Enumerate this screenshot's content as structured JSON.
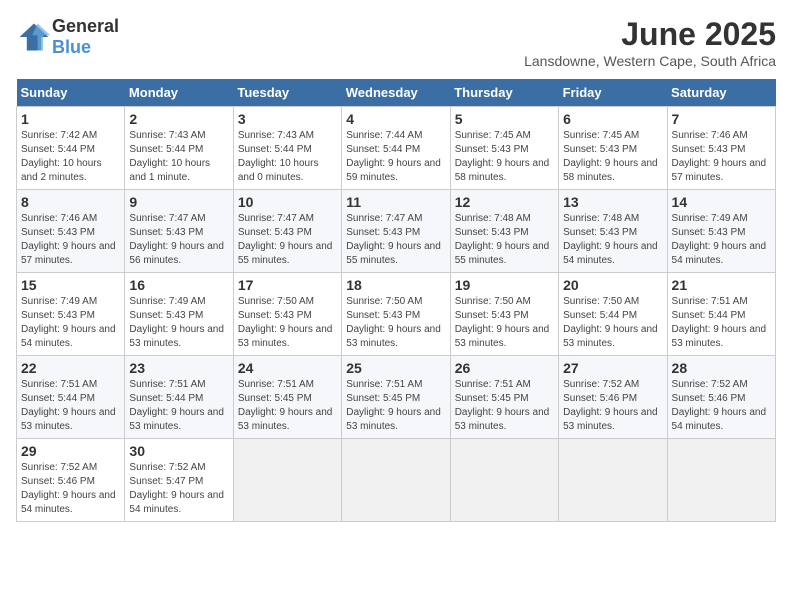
{
  "header": {
    "logo_general": "General",
    "logo_blue": "Blue",
    "title": "June 2025",
    "subtitle": "Lansdowne, Western Cape, South Africa"
  },
  "weekdays": [
    "Sunday",
    "Monday",
    "Tuesday",
    "Wednesday",
    "Thursday",
    "Friday",
    "Saturday"
  ],
  "weeks": [
    [
      {
        "day": "1",
        "sunrise": "Sunrise: 7:42 AM",
        "sunset": "Sunset: 5:44 PM",
        "daylight": "Daylight: 10 hours and 2 minutes."
      },
      {
        "day": "2",
        "sunrise": "Sunrise: 7:43 AM",
        "sunset": "Sunset: 5:44 PM",
        "daylight": "Daylight: 10 hours and 1 minute."
      },
      {
        "day": "3",
        "sunrise": "Sunrise: 7:43 AM",
        "sunset": "Sunset: 5:44 PM",
        "daylight": "Daylight: 10 hours and 0 minutes."
      },
      {
        "day": "4",
        "sunrise": "Sunrise: 7:44 AM",
        "sunset": "Sunset: 5:44 PM",
        "daylight": "Daylight: 9 hours and 59 minutes."
      },
      {
        "day": "5",
        "sunrise": "Sunrise: 7:45 AM",
        "sunset": "Sunset: 5:43 PM",
        "daylight": "Daylight: 9 hours and 58 minutes."
      },
      {
        "day": "6",
        "sunrise": "Sunrise: 7:45 AM",
        "sunset": "Sunset: 5:43 PM",
        "daylight": "Daylight: 9 hours and 58 minutes."
      },
      {
        "day": "7",
        "sunrise": "Sunrise: 7:46 AM",
        "sunset": "Sunset: 5:43 PM",
        "daylight": "Daylight: 9 hours and 57 minutes."
      }
    ],
    [
      {
        "day": "8",
        "sunrise": "Sunrise: 7:46 AM",
        "sunset": "Sunset: 5:43 PM",
        "daylight": "Daylight: 9 hours and 57 minutes."
      },
      {
        "day": "9",
        "sunrise": "Sunrise: 7:47 AM",
        "sunset": "Sunset: 5:43 PM",
        "daylight": "Daylight: 9 hours and 56 minutes."
      },
      {
        "day": "10",
        "sunrise": "Sunrise: 7:47 AM",
        "sunset": "Sunset: 5:43 PM",
        "daylight": "Daylight: 9 hours and 55 minutes."
      },
      {
        "day": "11",
        "sunrise": "Sunrise: 7:47 AM",
        "sunset": "Sunset: 5:43 PM",
        "daylight": "Daylight: 9 hours and 55 minutes."
      },
      {
        "day": "12",
        "sunrise": "Sunrise: 7:48 AM",
        "sunset": "Sunset: 5:43 PM",
        "daylight": "Daylight: 9 hours and 55 minutes."
      },
      {
        "day": "13",
        "sunrise": "Sunrise: 7:48 AM",
        "sunset": "Sunset: 5:43 PM",
        "daylight": "Daylight: 9 hours and 54 minutes."
      },
      {
        "day": "14",
        "sunrise": "Sunrise: 7:49 AM",
        "sunset": "Sunset: 5:43 PM",
        "daylight": "Daylight: 9 hours and 54 minutes."
      }
    ],
    [
      {
        "day": "15",
        "sunrise": "Sunrise: 7:49 AM",
        "sunset": "Sunset: 5:43 PM",
        "daylight": "Daylight: 9 hours and 54 minutes."
      },
      {
        "day": "16",
        "sunrise": "Sunrise: 7:49 AM",
        "sunset": "Sunset: 5:43 PM",
        "daylight": "Daylight: 9 hours and 53 minutes."
      },
      {
        "day": "17",
        "sunrise": "Sunrise: 7:50 AM",
        "sunset": "Sunset: 5:43 PM",
        "daylight": "Daylight: 9 hours and 53 minutes."
      },
      {
        "day": "18",
        "sunrise": "Sunrise: 7:50 AM",
        "sunset": "Sunset: 5:43 PM",
        "daylight": "Daylight: 9 hours and 53 minutes."
      },
      {
        "day": "19",
        "sunrise": "Sunrise: 7:50 AM",
        "sunset": "Sunset: 5:43 PM",
        "daylight": "Daylight: 9 hours and 53 minutes."
      },
      {
        "day": "20",
        "sunrise": "Sunrise: 7:50 AM",
        "sunset": "Sunset: 5:44 PM",
        "daylight": "Daylight: 9 hours and 53 minutes."
      },
      {
        "day": "21",
        "sunrise": "Sunrise: 7:51 AM",
        "sunset": "Sunset: 5:44 PM",
        "daylight": "Daylight: 9 hours and 53 minutes."
      }
    ],
    [
      {
        "day": "22",
        "sunrise": "Sunrise: 7:51 AM",
        "sunset": "Sunset: 5:44 PM",
        "daylight": "Daylight: 9 hours and 53 minutes."
      },
      {
        "day": "23",
        "sunrise": "Sunrise: 7:51 AM",
        "sunset": "Sunset: 5:44 PM",
        "daylight": "Daylight: 9 hours and 53 minutes."
      },
      {
        "day": "24",
        "sunrise": "Sunrise: 7:51 AM",
        "sunset": "Sunset: 5:45 PM",
        "daylight": "Daylight: 9 hours and 53 minutes."
      },
      {
        "day": "25",
        "sunrise": "Sunrise: 7:51 AM",
        "sunset": "Sunset: 5:45 PM",
        "daylight": "Daylight: 9 hours and 53 minutes."
      },
      {
        "day": "26",
        "sunrise": "Sunrise: 7:51 AM",
        "sunset": "Sunset: 5:45 PM",
        "daylight": "Daylight: 9 hours and 53 minutes."
      },
      {
        "day": "27",
        "sunrise": "Sunrise: 7:52 AM",
        "sunset": "Sunset: 5:46 PM",
        "daylight": "Daylight: 9 hours and 53 minutes."
      },
      {
        "day": "28",
        "sunrise": "Sunrise: 7:52 AM",
        "sunset": "Sunset: 5:46 PM",
        "daylight": "Daylight: 9 hours and 54 minutes."
      }
    ],
    [
      {
        "day": "29",
        "sunrise": "Sunrise: 7:52 AM",
        "sunset": "Sunset: 5:46 PM",
        "daylight": "Daylight: 9 hours and 54 minutes."
      },
      {
        "day": "30",
        "sunrise": "Sunrise: 7:52 AM",
        "sunset": "Sunset: 5:47 PM",
        "daylight": "Daylight: 9 hours and 54 minutes."
      },
      null,
      null,
      null,
      null,
      null
    ]
  ]
}
